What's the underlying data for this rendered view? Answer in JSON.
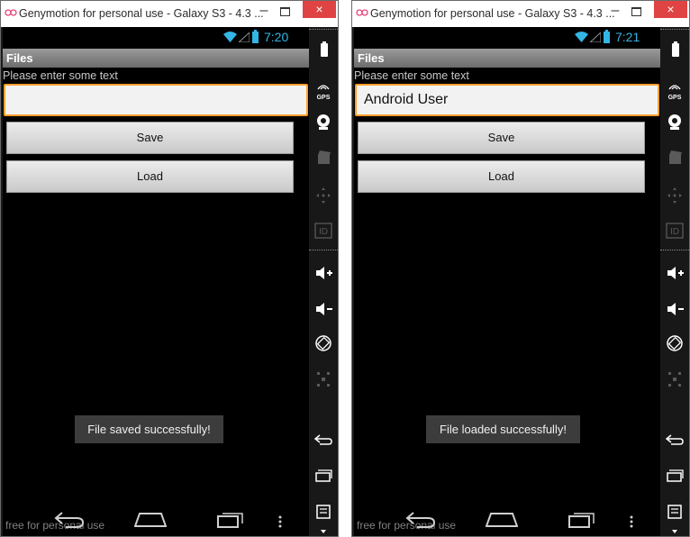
{
  "windows": [
    {
      "title": "Genymotion for personal use - Galaxy S3 - 4.3 ...",
      "status_time": "7:20",
      "app_title": "Files",
      "prompt": "Please enter some text",
      "input_value": "",
      "save_label": "Save",
      "load_label": "Load",
      "toast": "File saved successfully!",
      "watermark": "free for personal use"
    },
    {
      "title": "Genymotion for personal use - Galaxy S3 - 4.3 ...",
      "status_time": "7:21",
      "app_title": "Files",
      "prompt": "Please enter some text",
      "input_value": "Android User",
      "save_label": "Save",
      "load_label": "Load",
      "toast": "File loaded successfully!",
      "watermark": "free for personal use"
    }
  ],
  "titlebar_controls": {
    "minimize": "–",
    "close": "×"
  },
  "sidepanel": {
    "gps_label": "GPS",
    "id_label": "ID",
    "icons": [
      "battery-icon",
      "gps-icon",
      "webcam-icon",
      "clapper-icon",
      "dpad-icon",
      "id-icon",
      "volume-up-icon",
      "volume-down-icon",
      "rotate-icon",
      "pixel-perfect-icon",
      "back-icon",
      "recent-apps-icon",
      "menu-icon"
    ]
  },
  "colors": {
    "accent_blue": "#33b5e5",
    "input_focus": "#ff9e2c",
    "close_red": "#e04343",
    "toast_bg": "#3c3c3c",
    "genymotion_logo": "#e5437a"
  }
}
